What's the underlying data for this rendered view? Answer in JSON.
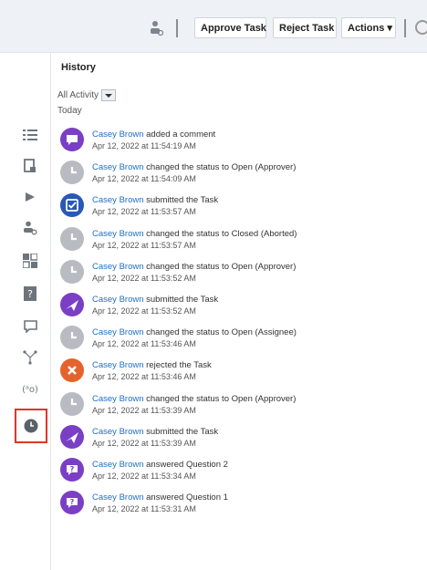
{
  "toolbar": {
    "approve_label": "Approve Task",
    "reject_label": "Reject Task",
    "actions_label": "Actions ▾"
  },
  "sidebar": {
    "items": [
      {
        "icon": "list-icon"
      },
      {
        "icon": "document-icon"
      },
      {
        "icon": "arrow-icon"
      },
      {
        "icon": "user-settings-icon"
      },
      {
        "icon": "grid-icon"
      },
      {
        "icon": "help-icon"
      },
      {
        "icon": "comment-icon"
      },
      {
        "icon": "workflow-icon"
      },
      {
        "icon": "variables-icon"
      },
      {
        "icon": "clock-icon",
        "active": true
      }
    ]
  },
  "history": {
    "title": "History",
    "filter_label": "All Activity",
    "today_label": "Today",
    "entries": [
      {
        "user": "Casey Brown",
        "action": "added a comment",
        "time": "Apr 12, 2022 at 11:54:19 AM",
        "icon": "comment-icon",
        "color": "#7a3fc4"
      },
      {
        "user": "Casey Brown",
        "action": "changed the status to Open (Approver)",
        "time": "Apr 12, 2022 at 11:54:09 AM",
        "icon": "clock-icon",
        "color": "#b8bcc2"
      },
      {
        "user": "Casey Brown",
        "action": "submitted the Task",
        "time": "Apr 12, 2022 at 11:53:57 AM",
        "icon": "approve-icon",
        "color": "#2a58b5"
      },
      {
        "user": "Casey Brown",
        "action": "changed the status to Closed (Aborted)",
        "time": "Apr 12, 2022 at 11:53:57 AM",
        "icon": "clock-icon",
        "color": "#b8bcc2"
      },
      {
        "user": "Casey Brown",
        "action": "changed the status to Open (Approver)",
        "time": "Apr 12, 2022 at 11:53:52 AM",
        "icon": "clock-icon",
        "color": "#b8bcc2"
      },
      {
        "user": "Casey Brown",
        "action": "submitted the Task",
        "time": "Apr 12, 2022 at 11:53:52 AM",
        "icon": "send-icon",
        "color": "#7a3fc4"
      },
      {
        "user": "Casey Brown",
        "action": "changed the status to Open (Assignee)",
        "time": "Apr 12, 2022 at 11:53:46 AM",
        "icon": "clock-icon",
        "color": "#b8bcc2"
      },
      {
        "user": "Casey Brown",
        "action": "rejected the Task",
        "time": "Apr 12, 2022 at 11:53:46 AM",
        "icon": "reject-icon",
        "color": "#e5622b"
      },
      {
        "user": "Casey Brown",
        "action": "changed the status to Open (Approver)",
        "time": "Apr 12, 2022 at 11:53:39 AM",
        "icon": "clock-icon",
        "color": "#b8bcc2"
      },
      {
        "user": "Casey Brown",
        "action": "submitted the Task",
        "time": "Apr 12, 2022 at 11:53:39 AM",
        "icon": "send-icon",
        "color": "#7a3fc4"
      },
      {
        "user": "Casey Brown",
        "action": "answered Question 2",
        "time": "Apr 12, 2022 at 11:53:34 AM",
        "icon": "question-icon",
        "color": "#7a3fc4"
      },
      {
        "user": "Casey Brown",
        "action": "answered Question 1",
        "time": "Apr 12, 2022 at 11:53:31 AM",
        "icon": "question-icon",
        "color": "#7a3fc4"
      }
    ]
  }
}
